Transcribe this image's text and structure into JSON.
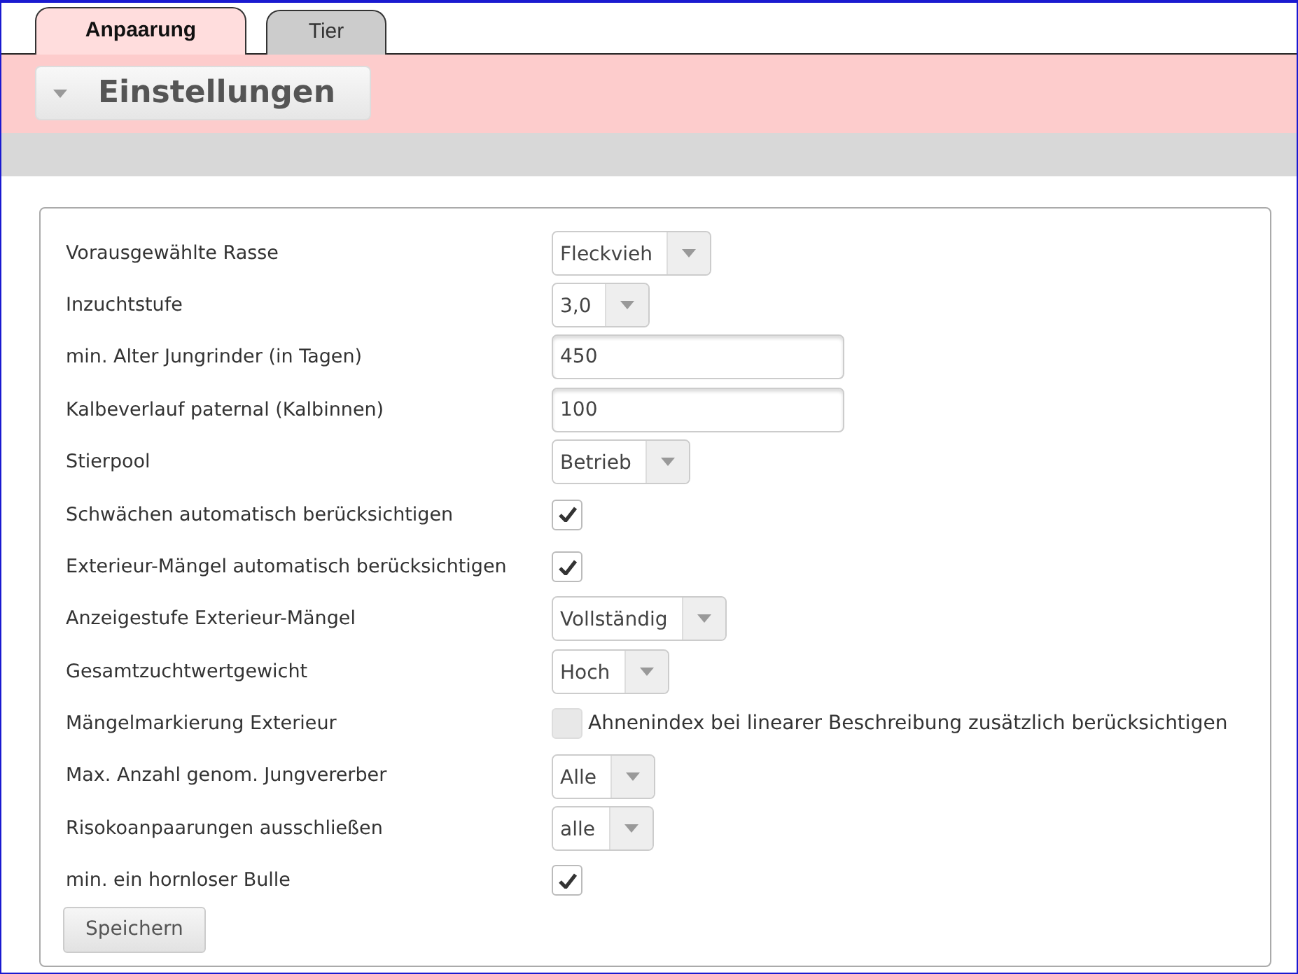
{
  "tabs": [
    {
      "label": "Anpaarung",
      "selected": true
    },
    {
      "label": "Tier",
      "selected": false
    }
  ],
  "section": {
    "title": "Einstellungen",
    "expanded": true
  },
  "settings": [
    {
      "label": "Vorausgewählte Rasse",
      "kind": "select",
      "value": "Fleckvieh"
    },
    {
      "label": "Inzuchtstufe",
      "kind": "select",
      "value": "3,0"
    },
    {
      "label": "min. Alter Jungrinder (in Tagen)",
      "kind": "text",
      "value": "450"
    },
    {
      "label": "Kalbeverlauf paternal (Kalbinnen)",
      "kind": "text",
      "value": "100"
    },
    {
      "label": "Stierpool",
      "kind": "select",
      "value": "Betrieb"
    },
    {
      "label": "Schwächen automatisch berücksichtigen",
      "kind": "checkbox",
      "checked": true
    },
    {
      "label": "Exterieur-Mängel automatisch berücksichtigen",
      "kind": "checkbox",
      "checked": true
    },
    {
      "label": "Anzeigestufe Exterieur-Mängel",
      "kind": "select",
      "value": "Vollständig"
    },
    {
      "label": "Gesamtzuchtwertgewicht",
      "kind": "select",
      "value": "Hoch"
    },
    {
      "label": "Mängelmarkierung Exterieur",
      "kind": "checkbox",
      "checked": false,
      "option": "Ahnenindex bei linearer Beschreibung zusätzlich berücksichtigen"
    },
    {
      "label": "Max. Anzahl genom. Jungvererber",
      "kind": "select",
      "value": "Alle"
    },
    {
      "label": "Risokoanpaarungen ausschließen",
      "kind": "select",
      "value": "alle"
    },
    {
      "label": "min. ein hornloser Bulle",
      "kind": "checkbox",
      "checked": true
    }
  ],
  "save_button": "Speichern"
}
